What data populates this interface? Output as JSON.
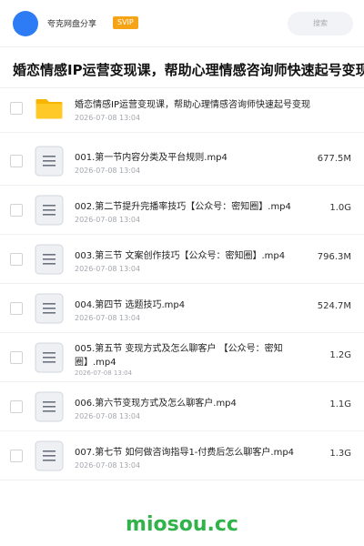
{
  "header": {
    "app_name": "夸克网盘分享",
    "badge": "SVIP",
    "search_placeholder": "搜索"
  },
  "share": {
    "title": "婚恋情感IP运营变现课，帮助心理情感咨询师快速起号变现"
  },
  "files": [
    {
      "name": "婚恋情感IP运营变现课，帮助心理情感咨询师快速起号变现",
      "date": "2026-07-08 13:04",
      "size": "",
      "type": "folder-icon"
    },
    {
      "name": "001.第一节内容分类及平台规则.mp4",
      "date": "2026-07-08 13:04",
      "size": "677.5M",
      "type": "file-icon"
    },
    {
      "name": "002.第二节提升完播率技巧【公众号：密知圈】.mp4",
      "date": "2026-07-08 13:04",
      "size": "1.0G",
      "type": "file-icon"
    },
    {
      "name": "003.第三节 文案创作技巧【公众号：密知圈】.mp4",
      "date": "2026-07-08 13:04",
      "size": "796.3M",
      "type": "file-icon"
    },
    {
      "name": "004.第四节 选题技巧.mp4",
      "date": "2026-07-08 13:04",
      "size": "524.7M",
      "type": "file-icon"
    },
    {
      "name": "005.第五节 变现方式及怎么聊客户 【公众号：密知圈】.mp4",
      "date": "2026-07-08 13:04",
      "size": "1.2G",
      "type": "file-icon"
    },
    {
      "name": "006.第六节变现方式及怎么聊客户.mp4",
      "date": "2026-07-08 13:04",
      "size": "1.1G",
      "type": "file-icon"
    },
    {
      "name": "007.第七节 如何做咨询指导1-付费后怎么聊客户.mp4",
      "date": "2026-07-08 13:04",
      "size": "1.3G",
      "type": "file-icon"
    }
  ],
  "watermark": "miosou.cc",
  "colors": {
    "avatar": "#2d7cf6",
    "svip": "#f6a417",
    "folder": "#f7b500",
    "watermark": "#31b24a"
  }
}
